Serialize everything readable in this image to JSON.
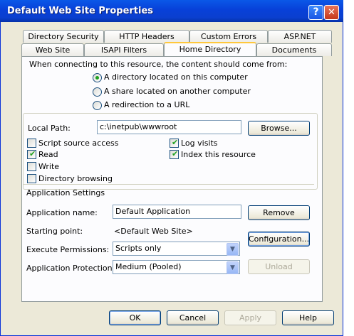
{
  "window": {
    "title": "Default Web Site Properties",
    "help_icon": "?",
    "close_icon": "✕"
  },
  "tabs": {
    "row1": [
      "Directory Security",
      "HTTP Headers",
      "Custom Errors",
      "ASP.NET"
    ],
    "row2": [
      "Web Site",
      "ISAPI Filters",
      "Home Directory",
      "Documents"
    ],
    "active": "Home Directory"
  },
  "source": {
    "prompt": "When connecting to this resource, the content should come from:",
    "options": [
      "A directory located on this computer",
      "A share located on another computer",
      "A redirection to a URL"
    ],
    "selected_index": 0
  },
  "local_path": {
    "label": "Local Path:",
    "value": "c:\\inetpub\\wwwroot",
    "browse_label": "Browse..."
  },
  "permissions": {
    "script_source_access": {
      "label": "Script source access",
      "checked": false
    },
    "read": {
      "label": "Read",
      "checked": true
    },
    "write": {
      "label": "Write",
      "checked": false
    },
    "directory_browsing": {
      "label": "Directory browsing",
      "checked": false
    },
    "log_visits": {
      "label": "Log visits",
      "checked": true
    },
    "index_resource": {
      "label": "Index this resource",
      "checked": true
    }
  },
  "app_settings": {
    "heading": "Application Settings",
    "name_label": "Application name:",
    "name_value": "Default Application",
    "remove_label": "Remove",
    "starting_point_label": "Starting point:",
    "starting_point_value": "<Default Web Site>",
    "configuration_label": "Configuration...",
    "execute_label": "Execute Permissions:",
    "execute_value": "Scripts only",
    "protection_label": "Application Protection:",
    "protection_value": "Medium (Pooled)",
    "unload_label": "Unload"
  },
  "footer": {
    "ok": "OK",
    "cancel": "Cancel",
    "apply": "Apply",
    "help": "Help"
  }
}
